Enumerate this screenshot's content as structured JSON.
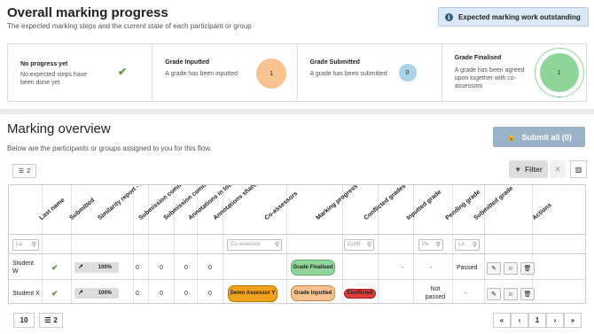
{
  "progress": {
    "title": "Overall marking progress",
    "subtitle": "The expected marking steps and the current state of each participant or group",
    "alert": "Expected marking work outstanding",
    "steps": [
      {
        "title": "No progress yet",
        "desc": "No expected steps have been done yet",
        "count": null,
        "color": ""
      },
      {
        "title": "Grade Inputted",
        "desc": "A grade has been inputted",
        "count": "1",
        "color": "#f6c28f"
      },
      {
        "title": "Grade Submitted",
        "desc": "A grade has been submitted",
        "count": "0",
        "color": "#a9d3e6"
      },
      {
        "title": "Grade Finalised",
        "desc": "A grade has been agreed upon together with co-assessors",
        "count": "1",
        "color": "#8fd59a"
      }
    ]
  },
  "overview": {
    "title": "Marking overview",
    "subtitle": "Below are the participants or groups assigned to you for this flow.",
    "submit_all": "Submit all (0)",
    "list_count": "2",
    "filter_label": "Filter",
    "columns": [
      "Last name",
      "Submitted",
      "Similarity report - ...",
      "Submission comm...",
      "Submission comm...",
      "Annotations in total",
      "Annotations share...",
      "Co-assessors",
      "Marking progress",
      "Conflicted grades",
      "Inputted grade",
      "Pending grade",
      "Submitted grade",
      "Actions"
    ],
    "filters": {
      "last_name": "La",
      "co_assessor": "Co-assessor",
      "conflicted": "Confl",
      "inputted": "Pe",
      "pending": "La"
    },
    "rows": [
      {
        "name": "Student W",
        "similarity": "100%",
        "c1": "0",
        "c2": "0",
        "a1": "0",
        "a2": "0",
        "coassessor": "",
        "progress": "Grade Finalised",
        "progress_color": "#8fd59a",
        "conflicted": "",
        "conflicted_marker": "-",
        "inputted": "-",
        "pending": "Passed",
        "submitted": ""
      },
      {
        "name": "Student X",
        "similarity": "100%",
        "c1": "0",
        "c2": "0",
        "a1": "0",
        "a2": "0",
        "coassessor": "Demo Assessor Y",
        "progress": "Grade Inputted",
        "progress_color": "#f6c28f",
        "conflicted": "Conflicted",
        "conflicted_marker": "",
        "inputted": "Not passed",
        "pending": "-",
        "submitted": ""
      }
    ],
    "page_size": "10",
    "footer_count": "2",
    "pager": {
      "first": "«",
      "prev": "‹",
      "page": "1",
      "next": "›",
      "last": "»"
    }
  }
}
